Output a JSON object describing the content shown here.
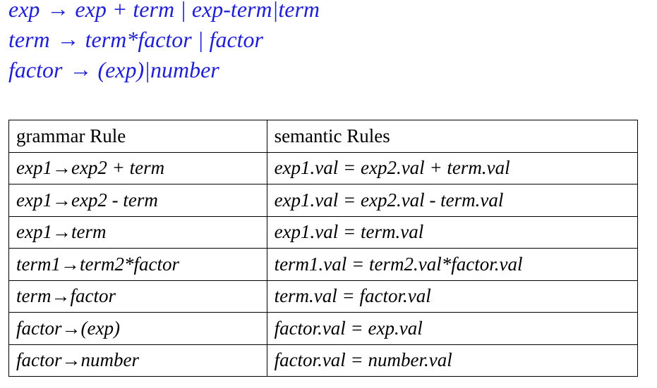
{
  "grammar": {
    "arrow_symbol": "→",
    "lines": [
      {
        "lhs": "exp",
        "rhs": "exp + term | exp-term|term"
      },
      {
        "lhs": "term",
        "rhs": "term*factor | factor"
      },
      {
        "lhs": "factor",
        "rhs": "(exp)|number"
      }
    ]
  },
  "table": {
    "headers": [
      "grammar Rule",
      "semantic Rules"
    ],
    "rows": [
      {
        "rule": "exp1→exp2 + term",
        "semantic": "exp1.val = exp2.val + term.val"
      },
      {
        "rule": "exp1→exp2 - term",
        "semantic": "exp1.val = exp2.val - term.val"
      },
      {
        "rule": "exp1→term",
        "semantic": "exp1.val = term.val"
      },
      {
        "rule": "term1→term2*factor",
        "semantic": "term1.val = term2.val*factor.val"
      },
      {
        "rule": "term→factor",
        "semantic": "term.val = factor.val"
      },
      {
        "rule": "factor→(exp)",
        "semantic": "factor.val = exp.val"
      },
      {
        "rule": "factor→number",
        "semantic": "factor.val = number.val"
      }
    ]
  },
  "colors": {
    "grammar_text": "#1f1fd6",
    "table_text": "#000000",
    "border": "#000000"
  }
}
